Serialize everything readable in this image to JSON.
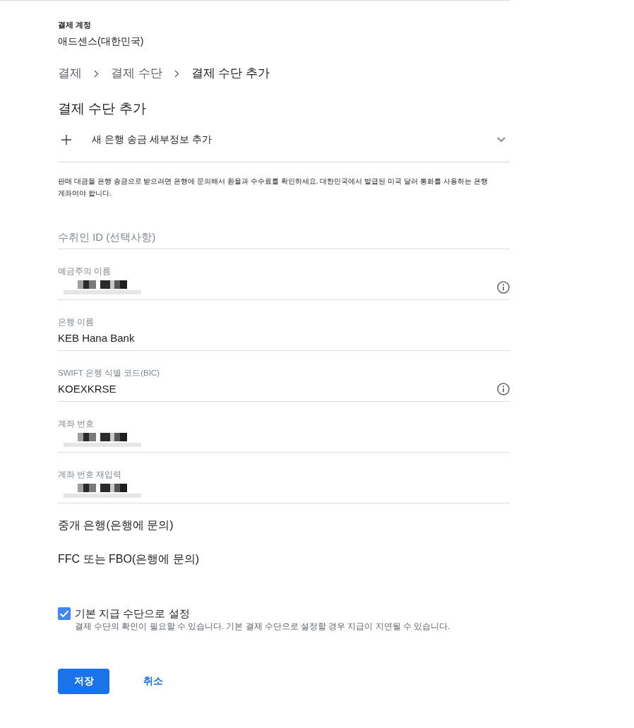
{
  "account": {
    "label": "결제 계정",
    "name": "애드센스(대한민국)"
  },
  "breadcrumb": [
    {
      "label": "결제",
      "current": false
    },
    {
      "label": "결제 수단",
      "current": false
    },
    {
      "label": "결제 수단 추가",
      "current": true
    }
  ],
  "heading": "결제 수단 추가",
  "add_panel": {
    "title": "새 은행 송금 세부정보 추가"
  },
  "notice": "판매 대금을 은행 송금으로 받으려면 은행에 문의해서 환율과 수수료를 확인하세요. 대한민국에서 발급된 미국 달러 통화를 사용하는 은행 계좌여야 합니다.",
  "fields": [
    {
      "placeholder": "수취인 ID (선택사항)"
    },
    {
      "label": "예금주의 이름",
      "redacted": true,
      "info": true
    },
    {
      "label": "은행 이름",
      "value": "KEB Hana Bank",
      "redacted": false,
      "info": false
    },
    {
      "label": "SWIFT 은행 식별 코드(BIC)",
      "value": "KOEXKRSE",
      "redacted": false,
      "info": true
    },
    {
      "label": "계좌 번호",
      "redacted": true,
      "info": false
    },
    {
      "label": "계좌 번호 재입력",
      "redacted": true,
      "info": false
    }
  ],
  "sections": [
    "중개 은행(은행에 문의)",
    "FFC 또는 FBO(은행에 문의)"
  ],
  "default_option": {
    "label": "기본 지급 수단으로 설정",
    "help": "결제 수단의 확인이 필요할 수 있습니다. 기본 결제 수단으로 설정할 경우 지급이 지연될 수 있습니다.",
    "checked": true
  },
  "buttons": {
    "save": "저장",
    "cancel": "취소"
  }
}
